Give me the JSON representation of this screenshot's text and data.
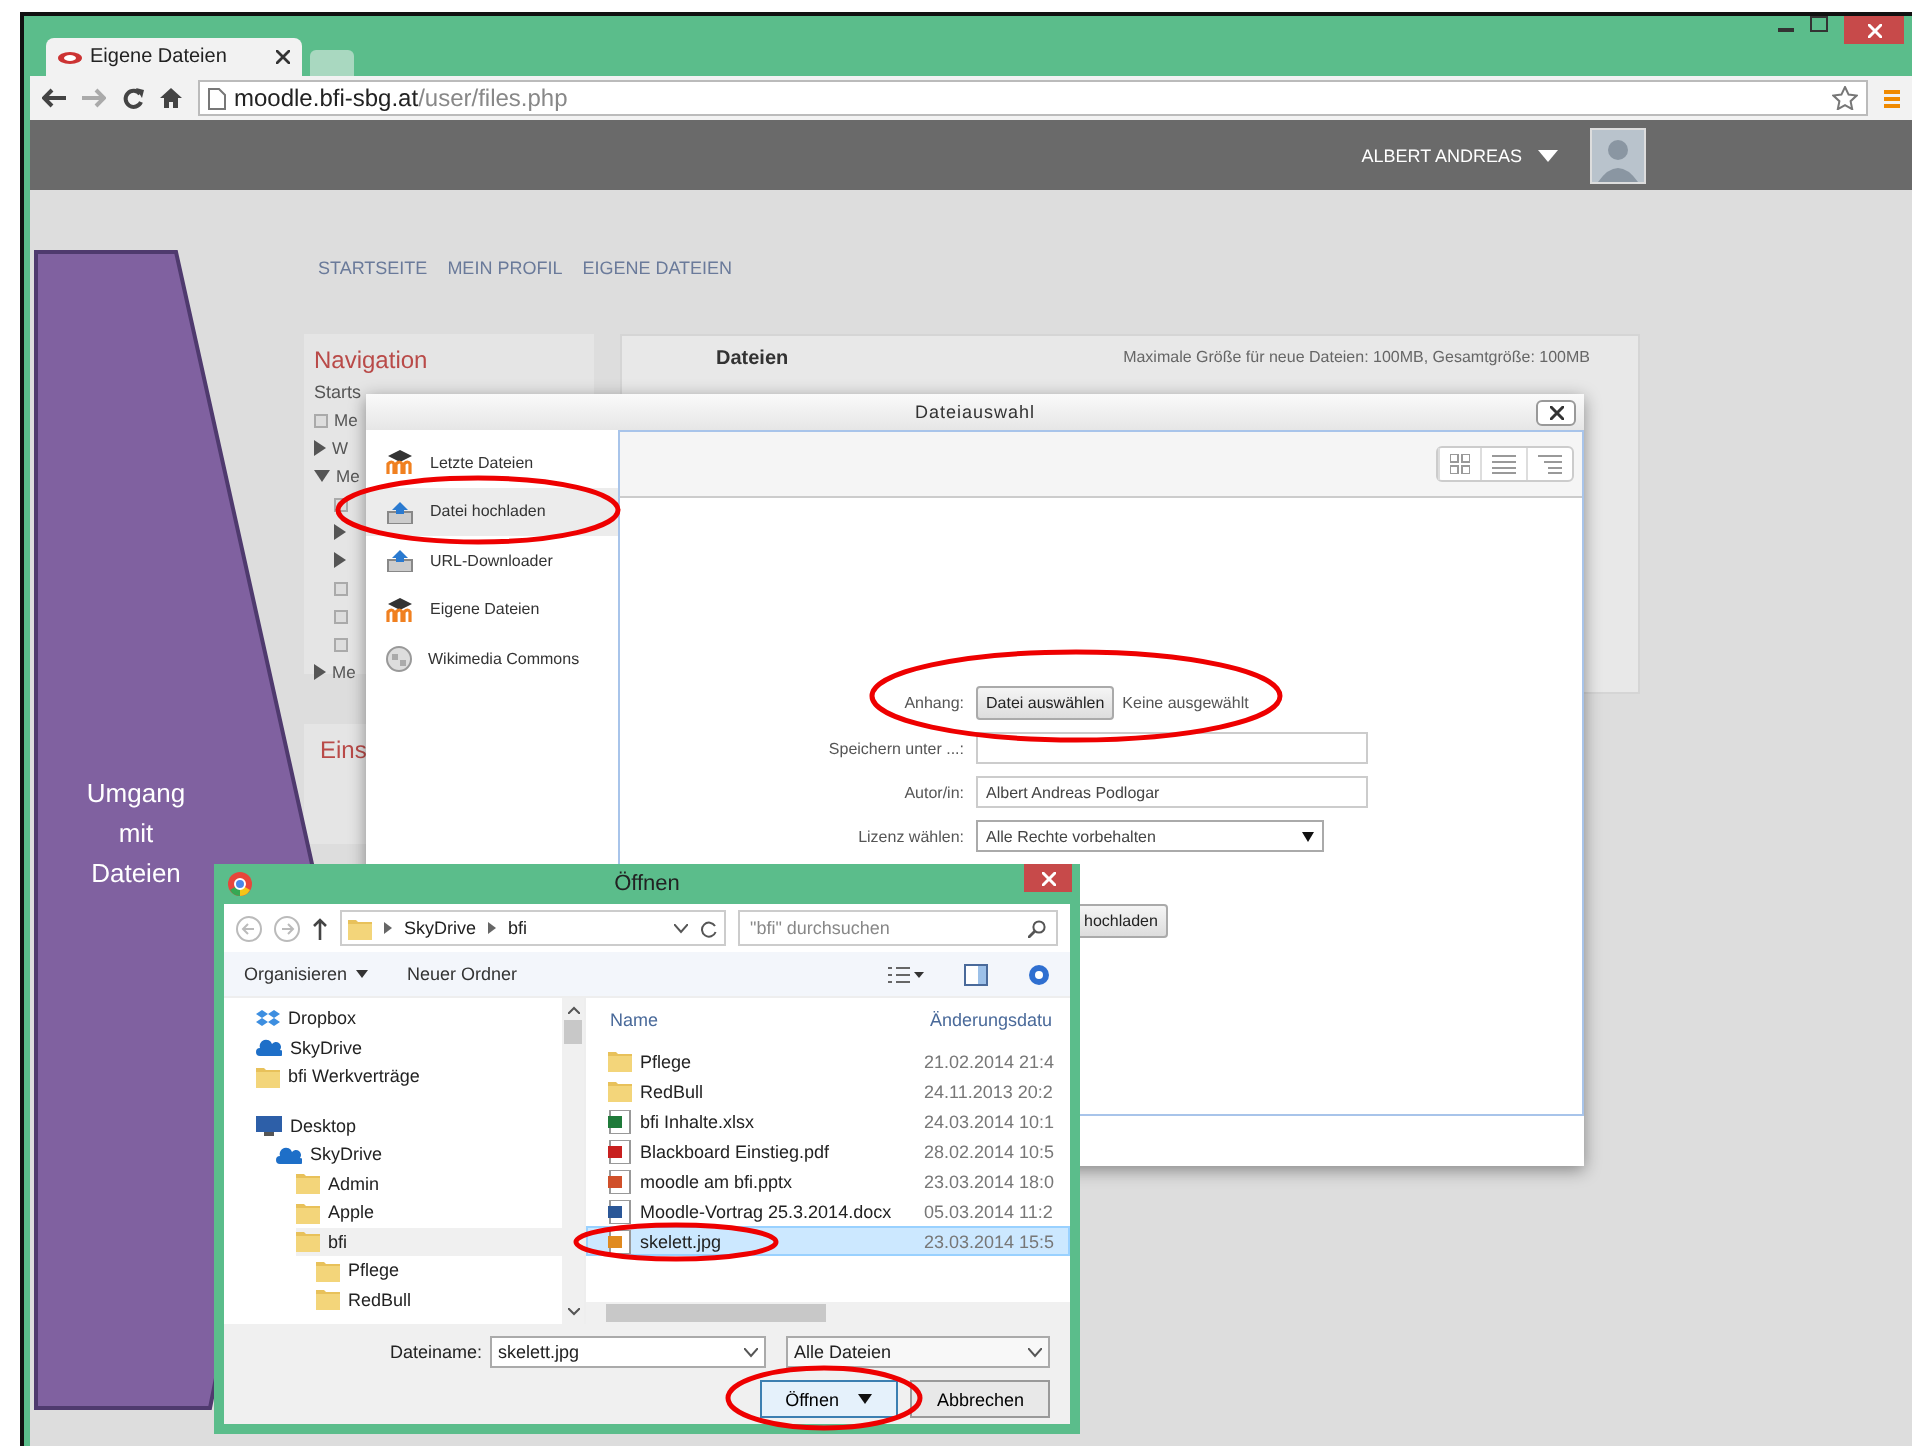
{
  "browser": {
    "tab_title": "Eigene Dateien",
    "address": {
      "host": "moodle.bfi-sbg.at",
      "path": "/user/files.php"
    }
  },
  "header": {
    "user_name": "ALBERT ANDREAS"
  },
  "breadcrumbs": [
    "STARTSEITE",
    "MEIN PROFIL",
    "EIGENE DATEIEN"
  ],
  "navigation": {
    "title": "Navigation",
    "first": "Starts",
    "items": [
      {
        "label": "Me",
        "kind": "leaf"
      },
      {
        "label": "W",
        "kind": "collapsed"
      },
      {
        "label": "Me",
        "kind": "expanded",
        "children": [
          {
            "kind": "leaf"
          },
          {
            "kind": "collapsed"
          },
          {
            "kind": "collapsed"
          },
          {
            "kind": "leaf"
          },
          {
            "kind": "leaf"
          },
          {
            "kind": "leaf"
          }
        ]
      },
      {
        "label": "Me",
        "kind": "collapsed"
      }
    ]
  },
  "settings_block": {
    "title": "Eins"
  },
  "files_panel": {
    "title": "Dateien",
    "limits": "Maximale Größe für neue Dateien: 100MB, Gesamtgröße: 100MB"
  },
  "file_picker": {
    "title": "Dateiauswahl",
    "sources": [
      {
        "label": "Letzte Dateien",
        "kind": "moodle",
        "selected": false
      },
      {
        "label": "Datei hochladen",
        "kind": "upload",
        "selected": true
      },
      {
        "label": "URL-Downloader",
        "kind": "upload",
        "selected": false
      },
      {
        "label": "Eigene Dateien",
        "kind": "moodle",
        "selected": false
      },
      {
        "label": "Wikimedia Commons",
        "kind": "globe",
        "selected": false
      }
    ],
    "attachment_label": "Anhang:",
    "choose_button": "Datei auswählen",
    "no_file": "Keine ausgewählt",
    "save_as_label": "Speichern unter ...:",
    "author_label": "Autor/in:",
    "author_value": "Albert Andreas Podlogar",
    "license_label": "Lizenz wählen:",
    "license_value": "Alle Rechte vorbehalten",
    "upload_button": "hochladen"
  },
  "open_dialog": {
    "title": "Öffnen",
    "path": [
      "SkyDrive",
      "bfi"
    ],
    "search_placeholder": "\"bfi\" durchsuchen",
    "organize": "Organisieren",
    "new_folder": "Neuer Ordner",
    "tree": [
      {
        "label": "Dropbox",
        "kind": "dropbox",
        "selected": false
      },
      {
        "label": "SkyDrive",
        "kind": "cloud",
        "selected": false
      },
      {
        "label": "bfi Werkverträge",
        "kind": "folder",
        "selected": false
      },
      {
        "label": "Desktop",
        "kind": "desktop",
        "selected": false,
        "children": [
          {
            "label": "SkyDrive",
            "kind": "cloud",
            "selected": false,
            "children": [
              {
                "label": "Admin",
                "kind": "folder",
                "selected": false
              },
              {
                "label": "Apple",
                "kind": "folder",
                "selected": false
              },
              {
                "label": "bfi",
                "kind": "folder",
                "selected": true,
                "children": [
                  {
                    "label": "Pflege",
                    "kind": "folder",
                    "selected": false
                  },
                  {
                    "label": "RedBull",
                    "kind": "folder",
                    "selected": false
                  }
                ]
              }
            ]
          }
        ]
      }
    ],
    "columns": [
      "Name",
      "Änderungsdatu"
    ],
    "files": [
      {
        "name": "Pflege",
        "date": "21.02.2014 21:4",
        "kind": "folder",
        "selected": false
      },
      {
        "name": "RedBull",
        "date": "24.11.2013 20:2",
        "kind": "folder",
        "selected": false
      },
      {
        "name": "bfi Inhalte.xlsx",
        "date": "24.03.2014 10:1",
        "kind": "xlsx",
        "selected": false
      },
      {
        "name": "Blackboard Einstieg.pdf",
        "date": "28.02.2014 10:5",
        "kind": "pdf",
        "selected": false
      },
      {
        "name": "moodle am bfi.pptx",
        "date": "23.03.2014 18:0",
        "kind": "pptx",
        "selected": false
      },
      {
        "name": "Moodle-Vortrag 25.3.2014.docx",
        "date": "05.03.2014 11:2",
        "kind": "docx",
        "selected": false
      },
      {
        "name": "skelett.jpg",
        "date": "23.03.2014 15:5",
        "kind": "jpg",
        "selected": true
      }
    ],
    "filename_label": "Dateiname:",
    "filename_value": "skelett.jpg",
    "filetype": "Alle Dateien",
    "open_button": "Öffnen",
    "cancel_button": "Abbrechen"
  },
  "callout": {
    "text": "Umgang mit Dateien"
  }
}
